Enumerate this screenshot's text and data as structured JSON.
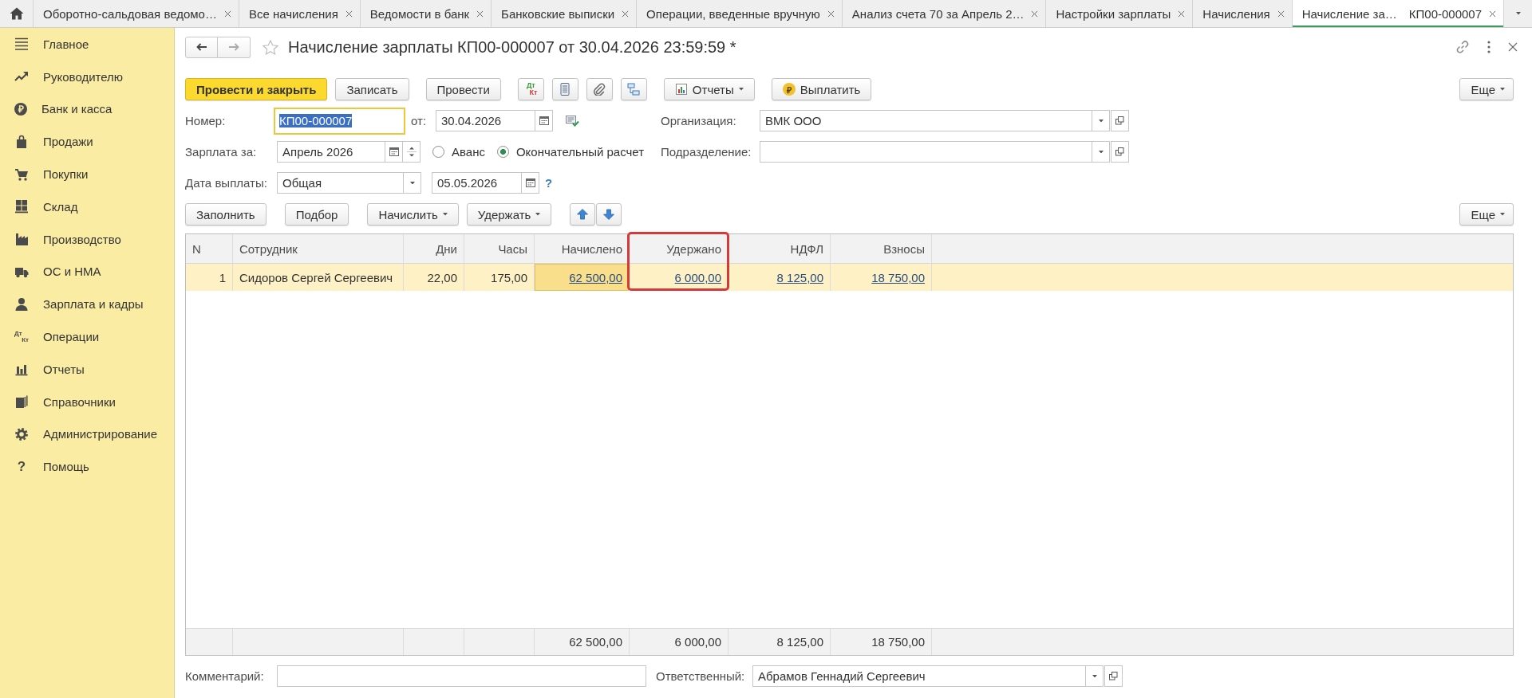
{
  "tabs": [
    {
      "label": "Оборотно-сальдовая ведомо…",
      "selected": false
    },
    {
      "label": "Все начисления",
      "selected": false
    },
    {
      "label": "Ведомости в банк",
      "selected": false
    },
    {
      "label": "Банковские выписки",
      "selected": false
    },
    {
      "label": "Операции, введенные вручную",
      "selected": false
    },
    {
      "label": "Анализ счета 70 за Апрель 2…",
      "selected": false
    },
    {
      "label": "Настройки зарплаты",
      "selected": false
    },
    {
      "label": "Начисления",
      "selected": false
    },
    {
      "label": "Начисление за…",
      "number": "КП00-000007",
      "selected": true
    }
  ],
  "sidebar": {
    "items": [
      {
        "label": "Главное"
      },
      {
        "label": "Руководителю"
      },
      {
        "label": "Банк и касса",
        "icon_text": [
          "₽"
        ]
      },
      {
        "label": "Продажи"
      },
      {
        "label": "Покупки"
      },
      {
        "label": "Склад"
      },
      {
        "label": "Производство"
      },
      {
        "label": "ОС и НМА"
      },
      {
        "label": "Зарплата и кадры"
      },
      {
        "label": "Операции",
        "icon_text": [
          "Дт",
          "Кт"
        ]
      },
      {
        "label": "Отчеты"
      },
      {
        "label": "Справочники"
      },
      {
        "label": "Администрирование"
      },
      {
        "label": "Помощь",
        "icon_text": [
          "?"
        ]
      }
    ]
  },
  "document": {
    "title": "Начисление зарплаты КП00-000007 от 30.04.2026 23:59:59 *"
  },
  "toolbar": {
    "buttons": [
      {
        "kind": "primary",
        "label": "Провести и закрыть",
        "menu": false
      },
      {
        "kind": "text",
        "label": "Записать",
        "menu": false
      },
      {
        "kind": "text",
        "label": "Провести",
        "menu": false
      },
      {
        "kind": "debit_credit",
        "icon_text": [
          "Дт",
          "Кт"
        ]
      },
      {
        "kind": "list"
      },
      {
        "kind": "attach"
      },
      {
        "kind": "structure"
      },
      {
        "kind": "reports",
        "label": "Отчеты",
        "menu": true
      },
      {
        "kind": "pay",
        "label": "Выплатить",
        "icon_text": [
          "₽"
        ],
        "menu": false
      }
    ],
    "more": {
      "label": "Еще",
      "menu": true
    }
  },
  "form": {
    "number": {
      "label": "Номер:",
      "value": "КП00-000007",
      "focused": true
    },
    "date": {
      "label": "от:",
      "value": "30.04.2026"
    },
    "organization": {
      "label": "Организация:",
      "value": "ВМК ООО"
    },
    "period": {
      "label": "Зарплата за:",
      "value": "Апрель 2026"
    },
    "payment_kind": [
      {
        "label": "Аванс",
        "selected": false
      },
      {
        "label": "Окончательный расчет",
        "selected": true
      }
    ],
    "department": {
      "label": "Подразделение:"
    },
    "payment_date": {
      "label": "Дата выплаты:",
      "value": "Общая",
      "date": "05.05.2026",
      "help": "?"
    }
  },
  "table_toolbar": {
    "buttons": [
      {
        "kind": "text",
        "label": "Заполнить",
        "menu": false
      },
      {
        "kind": "text",
        "label": "Подбор",
        "menu": false
      },
      {
        "kind": "text",
        "label": "Начислить",
        "menu": true
      },
      {
        "kind": "text",
        "label": "Удержать",
        "menu": true
      },
      {
        "kind": "up"
      },
      {
        "kind": "down"
      }
    ],
    "more": {
      "label": "Еще",
      "menu": true
    }
  },
  "table": {
    "columns": [
      {
        "label": "N",
        "kind": "index",
        "highlighted": false
      },
      {
        "label": "Сотрудник",
        "kind": "text",
        "highlighted": false
      },
      {
        "label": "Дни",
        "kind": "number",
        "highlighted": false
      },
      {
        "label": "Часы",
        "kind": "number",
        "highlighted": false
      },
      {
        "label": "Начислено",
        "kind": "number",
        "highlighted": false
      },
      {
        "label": "Удержано",
        "kind": "number",
        "highlighted": true
      },
      {
        "label": "НДФЛ",
        "kind": "number",
        "highlighted": false
      },
      {
        "label": "Взносы",
        "kind": "number",
        "highlighted": false
      }
    ],
    "rows": [
      {
        "selected": true,
        "cells": [
          {
            "text": "1",
            "link": false,
            "focused": false
          },
          {
            "text": "Сидоров Сергей Сергеевич",
            "link": false,
            "focused": false
          },
          {
            "text": "22,00",
            "link": false,
            "focused": false
          },
          {
            "text": "175,00",
            "link": false,
            "focused": false
          },
          {
            "text": "62 500,00",
            "link": true,
            "focused": true
          },
          {
            "text": "6 000,00",
            "link": true,
            "focused": false
          },
          {
            "text": "8 125,00",
            "link": true,
            "focused": false
          },
          {
            "text": "18 750,00",
            "link": true,
            "focused": false
          }
        ]
      }
    ],
    "totals": [
      "62 500,00",
      "6 000,00",
      "8 125,00",
      "18 750,00"
    ]
  },
  "footer": {
    "comment": {
      "label": "Комментарий:"
    },
    "responsible": {
      "label": "Ответственный:",
      "value": "Абрамов Геннадий Сергеевич"
    }
  }
}
